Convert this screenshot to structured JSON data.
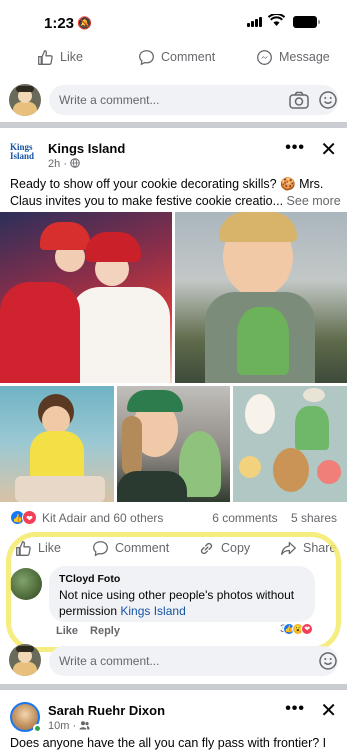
{
  "status": {
    "time": "1:23"
  },
  "top_actions": {
    "like": "Like",
    "comment": "Comment",
    "message": "Message"
  },
  "comment_box": {
    "placeholder": "Write a comment..."
  },
  "post": {
    "page_name": "Kings Island",
    "logo_text_line1": "Kings",
    "logo_text_line2": "Island",
    "time": "2h",
    "text": "Ready to show off your cookie decorating skills? 🍪 Mrs. Claus invites you to make festive cookie creatio...",
    "see_more": "See more",
    "reactions_text": "Kit Adair and 60 others",
    "comments_count": "6 comments",
    "shares_count": "5 shares",
    "actions": {
      "like": "Like",
      "comment": "Comment",
      "copy": "Copy",
      "share": "Share"
    },
    "comment": {
      "author": "TCloyd Foto",
      "text": "Not nice using other people's photos without permission",
      "mention": "Kings Island",
      "like": "Like",
      "reply": "Reply",
      "reaction_count": "3"
    }
  },
  "next_post": {
    "author": "Sarah Ruehr Dixon",
    "time": "10m",
    "text": "Does anyone have the all you can fly pass with frontier? I"
  },
  "colors": {
    "accent": "#1877f2",
    "highlight": "#f4ea6a",
    "separator": "#c9ccd1"
  }
}
